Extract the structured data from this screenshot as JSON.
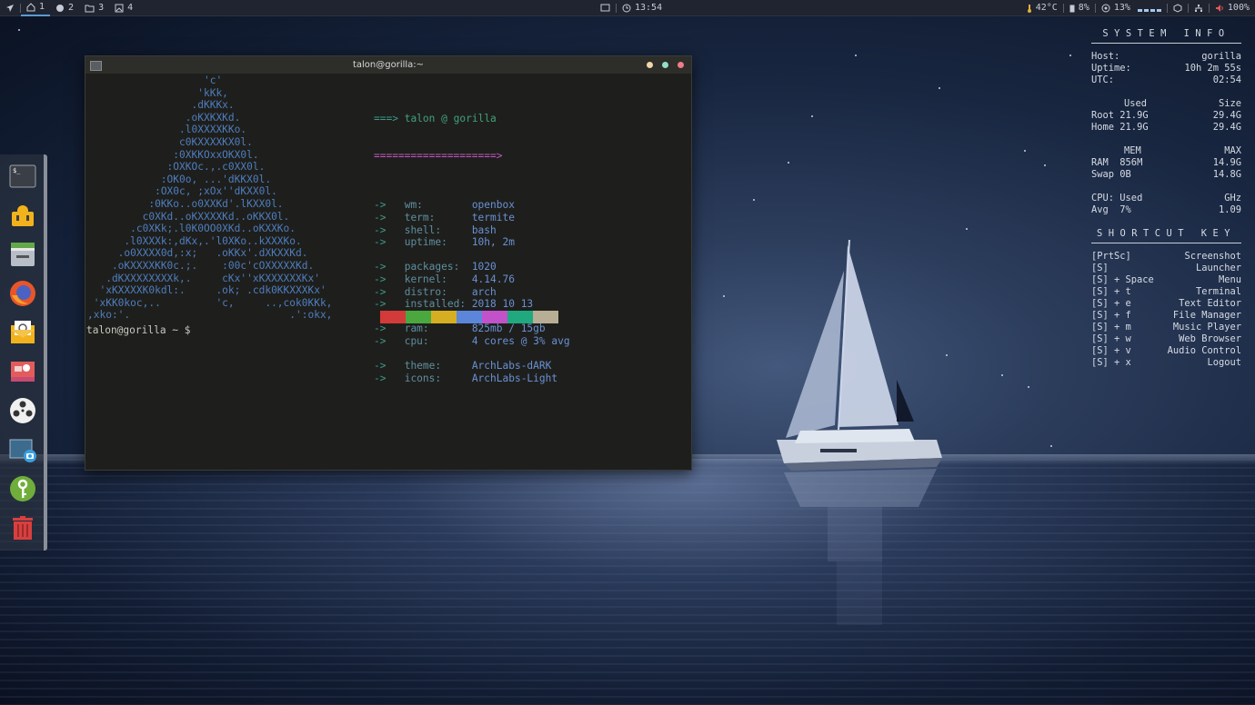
{
  "topbar": {
    "workspaces": [
      {
        "label": "1",
        "icon": "home-icon",
        "active": true
      },
      {
        "label": "2",
        "icon": "globe-icon",
        "active": false
      },
      {
        "label": "3",
        "icon": "folder-icon",
        "active": false
      },
      {
        "label": "4",
        "icon": "image-icon",
        "active": false
      }
    ],
    "clock": "13:54",
    "temperature": "42°C",
    "battery": "8%",
    "cpu": "13%",
    "volume": "100%"
  },
  "dock": {
    "items": [
      {
        "name": "terminal-icon"
      },
      {
        "name": "settings-icon"
      },
      {
        "name": "file-manager-icon"
      },
      {
        "name": "firefox-icon"
      },
      {
        "name": "mail-icon"
      },
      {
        "name": "image-viewer-icon"
      },
      {
        "name": "media-player-icon"
      },
      {
        "name": "screenshot-icon"
      },
      {
        "name": "keyring-icon"
      },
      {
        "name": "trash-icon"
      }
    ]
  },
  "terminal": {
    "title": "talon@gorilla:~",
    "header_arrow": "===>",
    "header_user": "talon",
    "header_at": "@",
    "header_host": "gorilla",
    "underline": "====================>",
    "groups": [
      [
        {
          "key": "wm:",
          "value": "openbox"
        },
        {
          "key": "term:",
          "value": "termite"
        },
        {
          "key": "shell:",
          "value": "bash"
        },
        {
          "key": "uptime:",
          "value": "10h, 2m"
        }
      ],
      [
        {
          "key": "packages:",
          "value": "1020"
        },
        {
          "key": "kernel:",
          "value": "4.14.76"
        },
        {
          "key": "distro:",
          "value": "arch"
        },
        {
          "key": "installed:",
          "value": "2018 10 13"
        }
      ],
      [
        {
          "key": "ram:",
          "value": "825mb / 15gb"
        },
        {
          "key": "cpu:",
          "value": "4 cores @ 3% avg"
        }
      ],
      [
        {
          "key": "theme:",
          "value": "ArchLabs-dARK"
        },
        {
          "key": "icons:",
          "value": "ArchLabs-Light"
        }
      ]
    ],
    "arrow": "->",
    "swatch_colors": [
      "#d33a3a",
      "#4aa83f",
      "#d6ae21",
      "#5b86d9",
      "#c152c9",
      "#20a97f",
      "#b7ae95"
    ],
    "prompt": "talon@gorilla ~ $"
  },
  "conky": {
    "system_title": "SYSTEM INFO",
    "host_label": "Host:",
    "host": "gorilla",
    "uptime_label": "Uptime:",
    "uptime": "10h 2m 55s",
    "utc_label": "UTC:",
    "utc": "02:54",
    "disk_used_label": "Used",
    "disk_size_label": "Size",
    "root_label": "Root",
    "root_used": "21.9G",
    "root_size": "29.4G",
    "home_label": "Home",
    "home_used": "21.9G",
    "home_size": "29.4G",
    "mem_label": "MEM",
    "max_label": "MAX",
    "ram_label": "RAM",
    "ram_used": "856M",
    "ram_max": "14.9G",
    "swap_label": "Swap",
    "swap_used": "0B",
    "swap_max": "14.8G",
    "cpu_label": "CPU:",
    "cpu_used_label": "Used",
    "ghz_label": "GHz",
    "avg_label": "Avg",
    "cpu_avg": "7%",
    "cpu_ghz": "1.09",
    "shortcut_title": "SHORTCUT KEY",
    "shortcuts": [
      {
        "key": "[PrtSc]",
        "action": "Screenshot"
      },
      {
        "key": "[S]",
        "action": "Launcher"
      },
      {
        "key": "[S] + Space",
        "action": "Menu"
      },
      {
        "key": "[S] + t",
        "action": "Terminal"
      },
      {
        "key": "[S] + e",
        "action": "Text Editor"
      },
      {
        "key": "[S] + f",
        "action": "File Manager"
      },
      {
        "key": "[S] + m",
        "action": "Music Player"
      },
      {
        "key": "[S] + w",
        "action": "Web Browser"
      },
      {
        "key": "[S] + v",
        "action": "Audio Control"
      },
      {
        "key": "[S] + x",
        "action": "Logout"
      }
    ]
  }
}
